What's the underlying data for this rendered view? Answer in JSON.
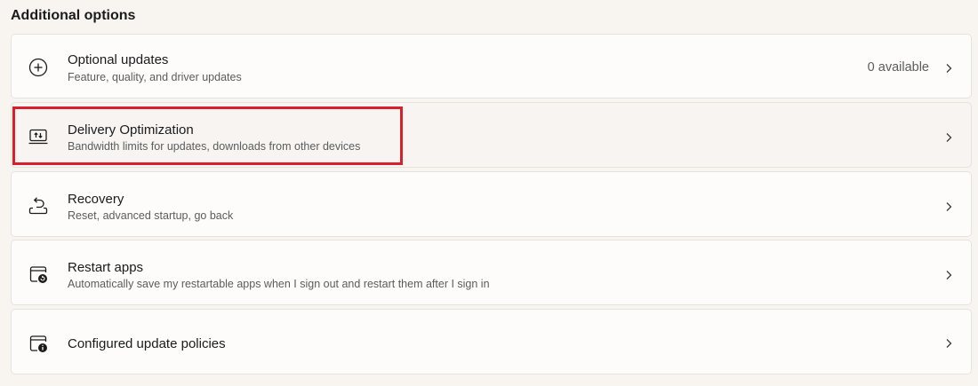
{
  "section": {
    "title": "Additional options"
  },
  "items": [
    {
      "title": "Optional updates",
      "subtitle": "Feature, quality, and driver updates",
      "status": "0 available",
      "icon": "plus-circle-icon"
    },
    {
      "title": "Delivery Optimization",
      "subtitle": "Bandwidth limits for updates, downloads from other devices",
      "icon": "delivery-optimization-icon"
    },
    {
      "title": "Recovery",
      "subtitle": "Reset, advanced startup, go back",
      "icon": "recovery-icon"
    },
    {
      "title": "Restart apps",
      "subtitle": "Automatically save my restartable apps when I sign out and restart them after I sign in",
      "icon": "restart-apps-icon"
    },
    {
      "title": "Configured update policies",
      "icon": "update-policies-icon"
    }
  ],
  "colors": {
    "highlight": "#d8202a",
    "card_background": "#fdfcfb",
    "page_background": "#f8f5f1"
  }
}
